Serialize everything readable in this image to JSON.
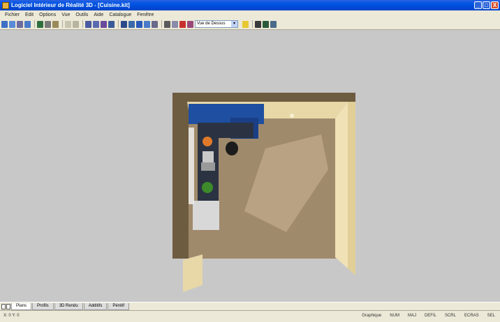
{
  "window": {
    "title": "Logiciel Intérieur de Réalité 3D - [Cuisine.kit]",
    "minimize": "_",
    "maximize": "□",
    "close": "X"
  },
  "menu": [
    "Fichier",
    "Edit",
    "Options",
    "Vue",
    "Outils",
    "Aide",
    "Catalogue",
    "Fenêtre"
  ],
  "toolbar": {
    "view_select": "Vue de Dessus"
  },
  "tabs": [
    {
      "label": "Plans"
    },
    {
      "label": "Profils"
    },
    {
      "label": "3D Rendu"
    },
    {
      "label": "Additifs"
    },
    {
      "label": "Pénitif"
    }
  ],
  "statusbar": {
    "coords": "X: 0  Y: 0",
    "mode": "Graphique",
    "indicators": [
      "NUM",
      "MAJ",
      "DEFIL",
      "SCRL",
      "ECRAS",
      "SEL"
    ]
  },
  "colors": {
    "floor": "#a08a6c",
    "walls": "#e8d8a8",
    "cabinets": "#1e4fa0",
    "background": "#c8c8c8"
  },
  "icons": [
    "zoom-in-icon",
    "zoom-out-icon",
    "hand-icon",
    "rotate-icon",
    "print-icon",
    "save-icon",
    "wall-icon",
    "door-icon",
    "window-icon",
    "furniture-icon",
    "camera-icon",
    "light-icon",
    "render-icon"
  ]
}
